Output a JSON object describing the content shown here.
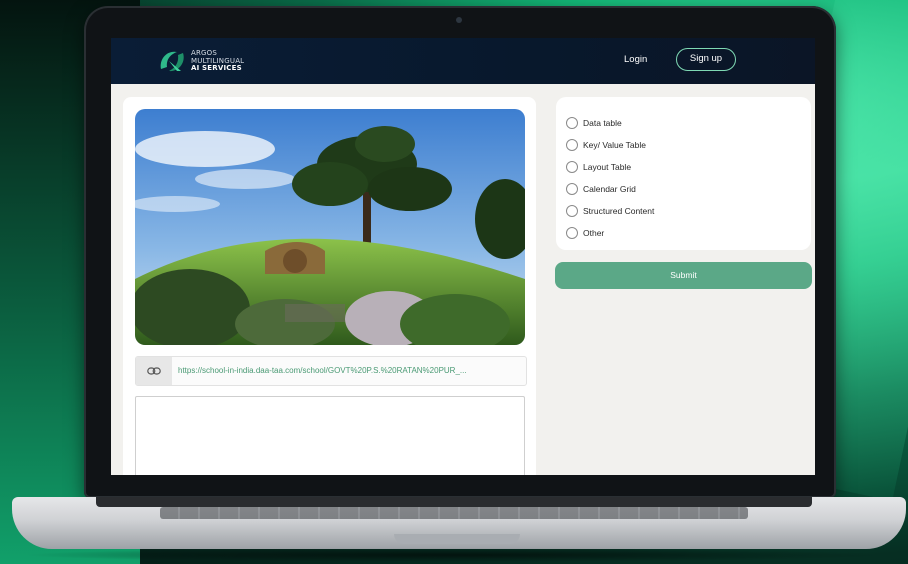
{
  "brand": {
    "line1": "ARGOS",
    "line2": "MULTILINGUAL",
    "line3": "AI SERVICES",
    "accent_color": "#5ba887"
  },
  "nav": {
    "login": "Login",
    "signup": "Sign up"
  },
  "media": {
    "image_icon": "landscape-photo",
    "url": "https://school-in-india.daa-taa.com/school/GOVT%20P.S.%20RATAN%20PUR_..."
  },
  "form": {
    "options": [
      "Data table",
      "Key/ Value Table",
      "Layout Table",
      "Calendar Grid",
      "Structured Content",
      "Other"
    ],
    "submit_label": "Submit"
  },
  "icons": {
    "link": "link-icon",
    "radio": "radio-unchecked-icon"
  }
}
